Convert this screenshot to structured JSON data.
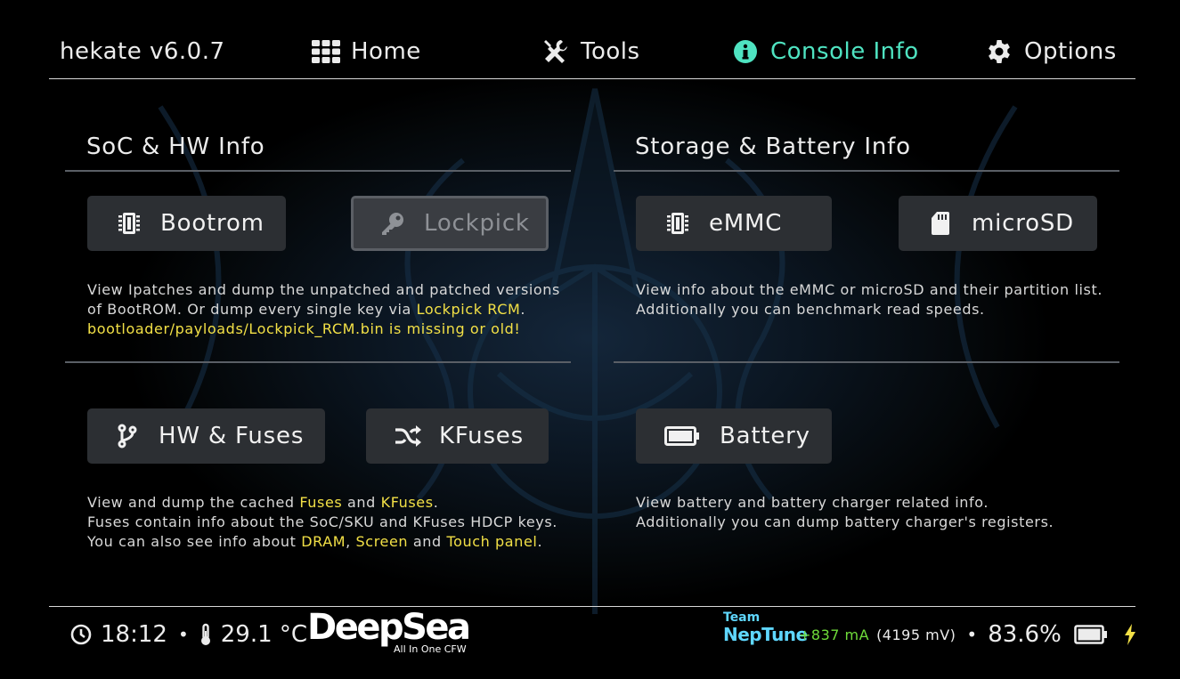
{
  "app": {
    "title": "hekate v6.0.7"
  },
  "nav": {
    "home": "Home",
    "tools": "Tools",
    "console_info": "Console Info",
    "options": "Options"
  },
  "sections": {
    "soc": {
      "title": "SoC & HW Info",
      "bootrom": "Bootrom",
      "lockpick": "Lockpick",
      "desc1_a": "View Ipatches and dump the unpatched and patched versions",
      "desc1_b": "of BootROM. Or dump every single key via ",
      "desc1_link": "Lockpick RCM",
      "desc1_end": ".",
      "desc1_warn": "bootloader/payloads/Lockpick_RCM.bin is missing or old!",
      "hw_fuses": "HW & Fuses",
      "kfuses": "KFuses",
      "desc2_a": "View and dump the cached ",
      "desc2_fuses": "Fuses",
      "desc2_and": " and ",
      "desc2_kfuses": "KFuses",
      "desc2_end": ".",
      "desc2_b": "Fuses contain info about the SoC/SKU and KFuses HDCP keys.",
      "desc2_c": "You can also see info about ",
      "desc2_dram": "DRAM",
      "desc2_comma": ", ",
      "desc2_screen": "Screen",
      "desc2_and2": " and ",
      "desc2_touch": "Touch panel",
      "desc2_c_end": "."
    },
    "storage": {
      "title": "Storage & Battery Info",
      "emmc": "eMMC",
      "microsd": "microSD",
      "desc1_a": "View info about the eMMC or microSD and their partition list.",
      "desc1_b": "Additionally you can benchmark read speeds.",
      "battery": "Battery",
      "desc2_a": "View battery and battery charger related info.",
      "desc2_b": "Additionally you can dump battery charger's registers."
    }
  },
  "footer": {
    "time": "18:12",
    "bullet": "•",
    "temp": "29.1 °C",
    "logo_main": "DeepSea",
    "logo_sub": "All In One CFW",
    "team_logo_top": "Team",
    "team_logo_bottom": "NepTune",
    "current": "+837 mA",
    "voltage": "(4195 mV)",
    "battery_pct": "83.6%"
  },
  "colors": {
    "accent": "#4fe3c1",
    "highlight": "#f2e046",
    "current": "#6fdc3a",
    "button_bg": "#2c2f33"
  },
  "icons": {
    "home": "grid-icon",
    "tools": "tools-icon",
    "console_info": "info-icon",
    "options": "gear-icon",
    "bootrom": "chip-icon",
    "lockpick": "key-icon",
    "emmc": "chip-icon",
    "microsd": "sd-card-icon",
    "hw_fuses": "branch-icon",
    "kfuses": "shuffle-icon",
    "battery": "battery-icon",
    "clock": "clock-icon",
    "temp": "thermometer-icon",
    "charging": "bolt-icon"
  }
}
